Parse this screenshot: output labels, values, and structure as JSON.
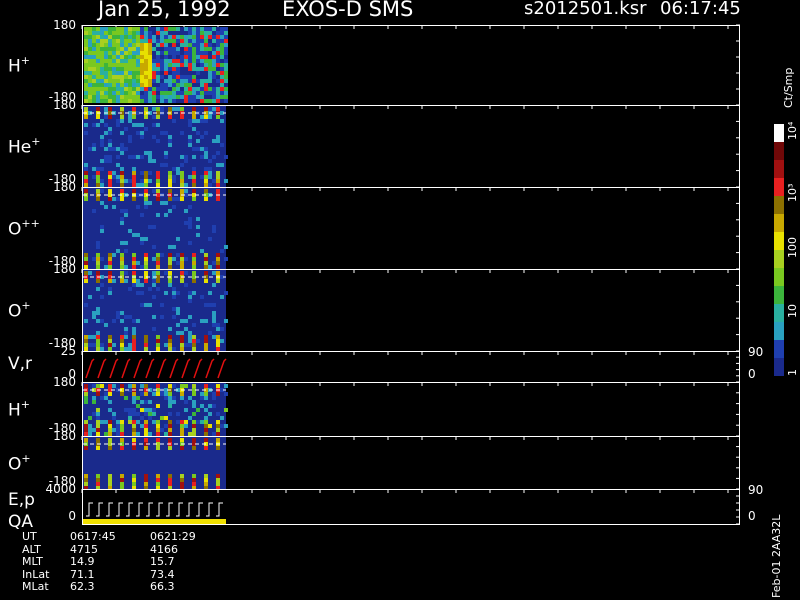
{
  "header": {
    "date": "Jan 25, 1992",
    "instrument": "EXOS-D SMS",
    "file": "s2012501.ksr",
    "time": "06:17:45"
  },
  "panels": [
    {
      "id": "h-plus",
      "label": "H",
      "charge": "+",
      "top_tick": "180",
      "bottom_tick": "-180"
    },
    {
      "id": "he-plus",
      "label": "He",
      "charge": "+",
      "top_tick": "180",
      "bottom_tick": "-180"
    },
    {
      "id": "o-plus-plus",
      "label": "O",
      "charge": "++",
      "top_tick": "180",
      "bottom_tick": "-180"
    },
    {
      "id": "o-plus",
      "label": "O",
      "charge": "+",
      "top_tick": "180",
      "bottom_tick": "-180"
    },
    {
      "id": "vr",
      "label": "V,r",
      "charge": "",
      "top_tick": "25",
      "bottom_tick": "0",
      "right_top": "90",
      "right_bottom": "0"
    },
    {
      "id": "h-plus-2",
      "label": "H",
      "charge": "+",
      "top_tick": "180",
      "bottom_tick": "-180"
    },
    {
      "id": "o-plus-2",
      "label": "O",
      "charge": "+",
      "top_tick": "180",
      "bottom_tick": "-180"
    },
    {
      "id": "ep-qa",
      "label": "E,p",
      "label2": "QA",
      "charge": "",
      "top_tick": "4000",
      "bottom_tick": "0",
      "right_top": "90",
      "right_bottom": "0"
    }
  ],
  "colorbar": {
    "unit": "Ct/Smp",
    "labels": [
      "10⁴",
      "10³",
      "100",
      "10",
      "1"
    ]
  },
  "footer": {
    "rows": [
      {
        "name": "UT",
        "v1": "0617:45",
        "v2": "0621:29"
      },
      {
        "name": "ALT",
        "v1": "4715",
        "v2": "4166"
      },
      {
        "name": "MLT",
        "v1": "14.9",
        "v2": "15.7"
      },
      {
        "name": "InLat",
        "v1": "71.1",
        "v2": "73.4"
      },
      {
        "name": "MLat",
        "v1": "62.3",
        "v2": "66.3"
      }
    ],
    "side_label": "Feb-01 2AA32L"
  },
  "chart_data": {
    "type": "heatmap",
    "title": "Jan 25, 1992   EXOS-D SMS",
    "time_axis": [
      "0617:45",
      "0621:29"
    ],
    "pitch_angle_range": [
      -180,
      180
    ],
    "colorbar_scale": "log",
    "colorbar_range": [
      1,
      10000
    ],
    "colors": [
      "#1a2a8c",
      "#1f3fb0",
      "#2aa0c0",
      "#2ab0a0",
      "#3cb43c",
      "#7ac820",
      "#a8d020",
      "#e8e000",
      "#c8a800",
      "#8c7000",
      "#e82020",
      "#a01010",
      "#700808",
      "#ffffff"
    ]
  }
}
